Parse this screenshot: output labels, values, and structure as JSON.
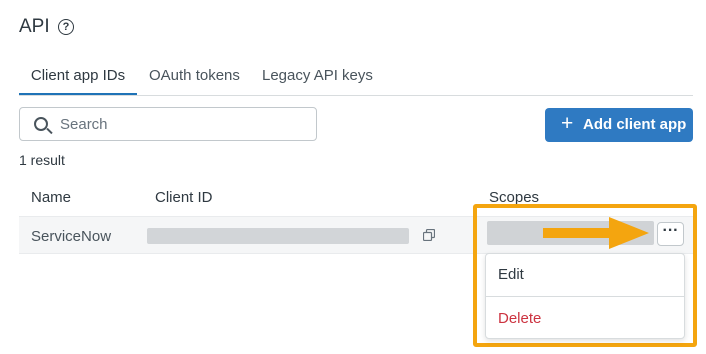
{
  "page": {
    "title": "API"
  },
  "tabs": [
    {
      "label": "Client app IDs",
      "active": true
    },
    {
      "label": "OAuth tokens",
      "active": false
    },
    {
      "label": "Legacy API keys",
      "active": false
    }
  ],
  "search": {
    "placeholder": "Search"
  },
  "actions": {
    "add_label": "Add client app",
    "add_icon": "plus-icon"
  },
  "results": {
    "count_text": "1 result"
  },
  "table": {
    "columns": [
      "Name",
      "Client ID",
      "Scopes"
    ],
    "rows": [
      {
        "name": "ServiceNow"
      }
    ]
  },
  "row_menu": {
    "items": [
      "Edit",
      "Delete"
    ],
    "delete_color": "#cc3340"
  },
  "colors": {
    "accent": "#2f7ac2",
    "highlight": "#f4a50f",
    "danger": "#cc3340"
  }
}
